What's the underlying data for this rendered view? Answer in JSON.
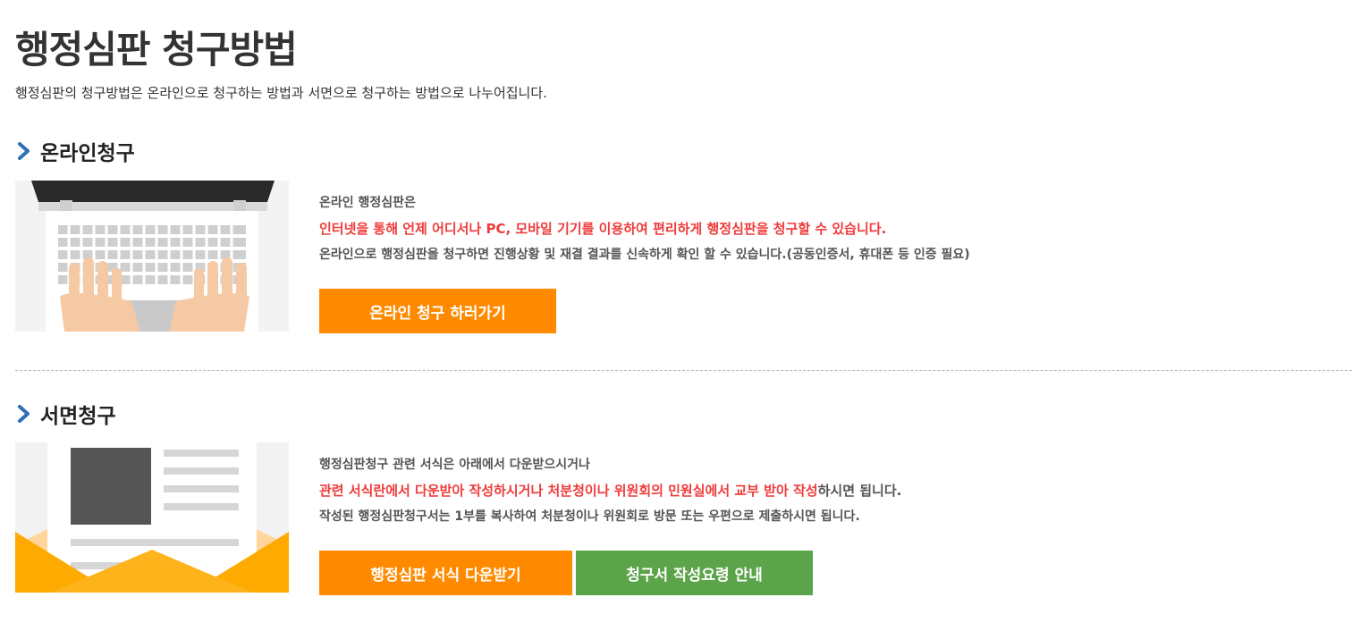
{
  "title": "행정심판 청구방법",
  "description": "행정심판의 청구방법은 온라인으로 청구하는 방법과 서면으로 청구하는 방법으로 나누어집니다.",
  "online": {
    "heading": "온라인청구",
    "icon": "laptop-illustration",
    "line1": "온라인 행정심판은",
    "line2": "인터넷을 통해 언제 어디서나 PC, 모바일 기기를 이용하여 편리하게 행정심판을 청구할 수 있습니다.",
    "line3": "온라인으로 행정심판을 청구하면 진행상황 및 재결 결과를 신속하게 확인 할 수 있습니다.(공동인증서, 휴대폰 등 인증 필요)",
    "button": "온라인 청구 하러가기"
  },
  "paper": {
    "heading": "서면청구",
    "icon": "document-envelope-illustration",
    "line1": "행정심판청구 관련 서식은 아래에서 다운받으시거나",
    "line2_red": "관련 서식란에서 다운받아 작성하시거나 처분청이나 위원회의 민원실에서 교부 받아 작성",
    "line2_rest": "하시면 됩니다.",
    "line3": "작성된 행정심판청구서는 1부를 복사하여 처분청이나 위원회로 방문 또는 우편으로 제출하시면 됩니다.",
    "button_download": "행정심판 서식 다운받기",
    "button_guide": "청구서 작성요령 안내"
  },
  "colors": {
    "accent_orange": "#ff8a00",
    "accent_green": "#5ba44a",
    "highlight_red": "#ef3b3b",
    "chevron_blue": "#2f6fb5"
  }
}
